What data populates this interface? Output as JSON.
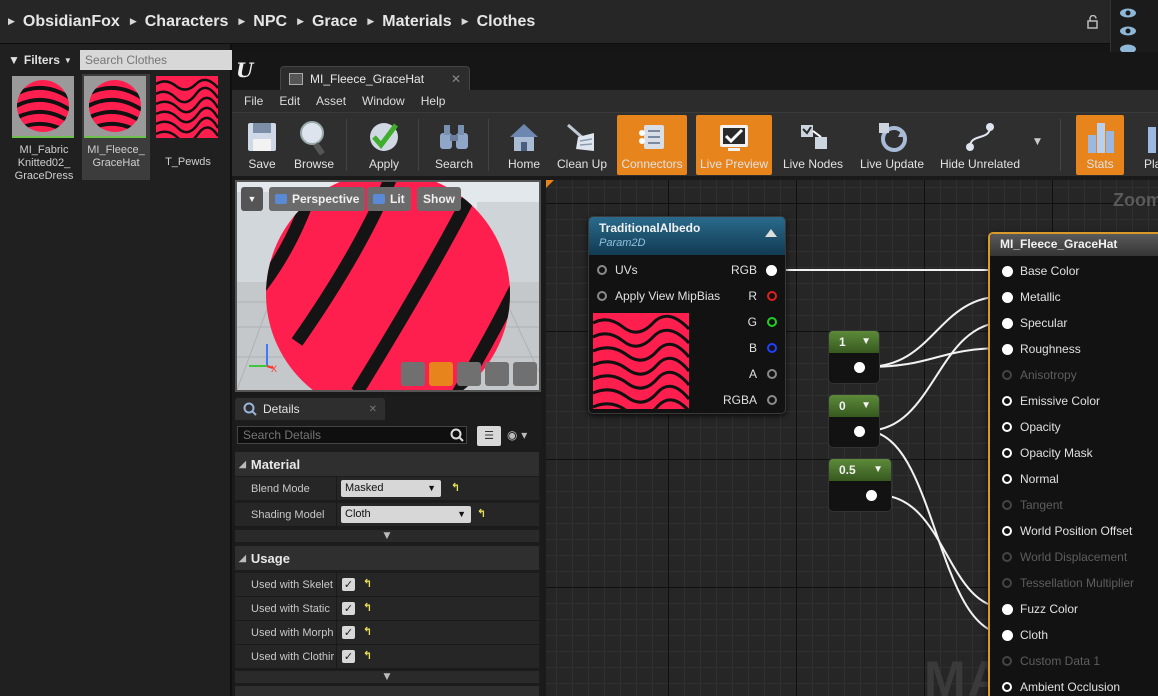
{
  "breadcrumb": [
    "ObsidianFox",
    "Characters",
    "NPC",
    "Grace",
    "Materials",
    "Clothes"
  ],
  "content_browser": {
    "filters_label": "Filters",
    "search_placeholder": "Search Clothes",
    "assets": [
      {
        "name": "MI_Fabric Knitted02_ GraceDress",
        "selected": false
      },
      {
        "name": "MI_Fleece_ GraceHat",
        "selected": true
      },
      {
        "name": "T_Pewds",
        "selected": false
      }
    ]
  },
  "editor": {
    "tab_title": "MI_Fleece_GraceHat",
    "menu": [
      "File",
      "Edit",
      "Asset",
      "Window",
      "Help"
    ],
    "toolbar": [
      {
        "label": "Save",
        "icon": "save-icon",
        "active": false
      },
      {
        "label": "Browse",
        "icon": "browse-icon",
        "active": false
      },
      {
        "label": "Apply",
        "icon": "apply-icon",
        "active": false
      },
      {
        "label": "Search",
        "icon": "search-icon",
        "active": false
      },
      {
        "label": "Home",
        "icon": "home-icon",
        "active": false
      },
      {
        "label": "Clean Up",
        "icon": "clean-up-icon",
        "active": false
      },
      {
        "label": "Connectors",
        "icon": "connectors-icon",
        "active": true
      },
      {
        "label": "Live Preview",
        "icon": "live-preview-icon",
        "active": true
      },
      {
        "label": "Live Nodes",
        "icon": "live-nodes-icon",
        "active": false
      },
      {
        "label": "Live Update",
        "icon": "live-update-icon",
        "active": false
      },
      {
        "label": "Hide Unrelated",
        "icon": "hide-unrelated-icon",
        "active": false
      },
      {
        "label": "Stats",
        "icon": "stats-icon",
        "active": true
      },
      {
        "label": "Platf",
        "icon": "platform-icon",
        "active": false
      }
    ],
    "viewport": {
      "perspective": "Perspective",
      "lit": "Lit",
      "show": "Show"
    },
    "details": {
      "tab": "Details",
      "search_placeholder": "Search Details",
      "material_section": "Material",
      "blend_mode_label": "Blend Mode",
      "blend_mode_value": "Masked",
      "shading_model_label": "Shading Model",
      "shading_model_value": "Cloth",
      "usage_section": "Usage",
      "usage_items": [
        {
          "label": "Used with Skelet",
          "checked": true
        },
        {
          "label": "Used with Static",
          "checked": true
        },
        {
          "label": "Used with Morph",
          "checked": true
        },
        {
          "label": "Used with Clothir",
          "checked": true
        }
      ]
    },
    "graph": {
      "zoom_label": "Zoom",
      "watermark": "MATERIA",
      "texture_node": {
        "title": "TraditionalAlbedo",
        "subtitle": "Param2D",
        "inputs": [
          "UVs",
          "Apply View MipBias"
        ],
        "outputs": [
          {
            "label": "RGB",
            "color": "#ffffff",
            "connected": true
          },
          {
            "label": "R",
            "color": "#e02020",
            "connected": false
          },
          {
            "label": "G",
            "color": "#20d020",
            "connected": false
          },
          {
            "label": "B",
            "color": "#2040ff",
            "connected": false
          },
          {
            "label": "A",
            "color": "#9a9a9a",
            "connected": false
          },
          {
            "label": "RGBA",
            "color": "#9a9a9a",
            "connected": false
          }
        ]
      },
      "constants": [
        "1",
        "0",
        "0.5"
      ],
      "material_node": {
        "title": "MI_Fleece_GraceHat",
        "inputs": [
          {
            "label": "Base Color",
            "enabled": true,
            "connected": true
          },
          {
            "label": "Metallic",
            "enabled": true,
            "connected": true
          },
          {
            "label": "Specular",
            "enabled": true,
            "connected": true
          },
          {
            "label": "Roughness",
            "enabled": true,
            "connected": true
          },
          {
            "label": "Anisotropy",
            "enabled": false,
            "connected": false
          },
          {
            "label": "Emissive Color",
            "enabled": true,
            "connected": false
          },
          {
            "label": "Opacity",
            "enabled": true,
            "connected": false
          },
          {
            "label": "Opacity Mask",
            "enabled": true,
            "connected": false
          },
          {
            "label": "Normal",
            "enabled": true,
            "connected": false
          },
          {
            "label": "Tangent",
            "enabled": false,
            "connected": false
          },
          {
            "label": "World Position Offset",
            "enabled": true,
            "connected": false
          },
          {
            "label": "World Displacement",
            "enabled": false,
            "connected": false
          },
          {
            "label": "Tessellation Multiplier",
            "enabled": false,
            "connected": false
          },
          {
            "label": "Fuzz Color",
            "enabled": true,
            "connected": true
          },
          {
            "label": "Cloth",
            "enabled": true,
            "connected": true
          },
          {
            "label": "Custom Data 1",
            "enabled": false,
            "connected": false
          },
          {
            "label": "Ambient Occlusion",
            "enabled": true,
            "connected": false
          }
        ]
      }
    }
  },
  "colors": {
    "accent_orange": "#e8841c",
    "texture_header": "#1f5a78",
    "material_header": "#4a4a4a",
    "constant_header": "#4e7a30",
    "pink": "#ff1f4e"
  }
}
